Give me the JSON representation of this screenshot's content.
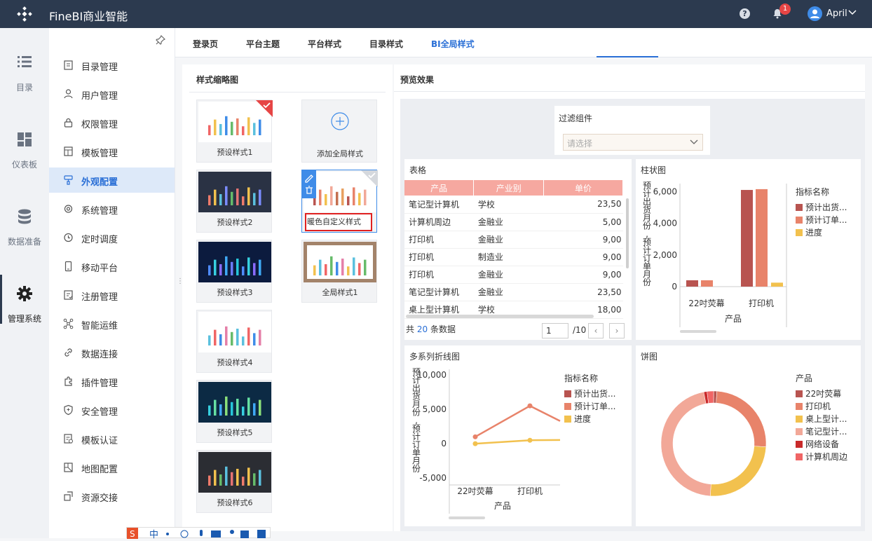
{
  "header": {
    "title": "FineBI商业智能",
    "notifications": "1",
    "user": "April"
  },
  "rail": [
    {
      "label": "目录",
      "icon": "list-icon"
    },
    {
      "label": "仪表板",
      "icon": "dashboard-icon"
    },
    {
      "label": "数据准备",
      "icon": "database-icon"
    },
    {
      "label": "管理系统",
      "icon": "gear-icon"
    }
  ],
  "menu": [
    {
      "label": "目录管理",
      "icon": "catalog-icon"
    },
    {
      "label": "用户管理",
      "icon": "user-icon"
    },
    {
      "label": "权限管理",
      "icon": "lock-icon"
    },
    {
      "label": "模板管理",
      "icon": "template-icon"
    },
    {
      "label": "外观配置",
      "icon": "brush-icon"
    },
    {
      "label": "系统管理",
      "icon": "gear-icon"
    },
    {
      "label": "定时调度",
      "icon": "clock-icon"
    },
    {
      "label": "移动平台",
      "icon": "mobile-icon"
    },
    {
      "label": "注册管理",
      "icon": "register-icon"
    },
    {
      "label": "智能运维",
      "icon": "ops-icon"
    },
    {
      "label": "数据连接",
      "icon": "link-icon"
    },
    {
      "label": "插件管理",
      "icon": "plugin-icon"
    },
    {
      "label": "安全管理",
      "icon": "shield-icon"
    },
    {
      "label": "模板认证",
      "icon": "certify-icon"
    },
    {
      "label": "地图配置",
      "icon": "map-icon"
    },
    {
      "label": "资源交接",
      "icon": "transfer-icon"
    }
  ],
  "tabs": [
    "登录页",
    "平台主题",
    "平台样式",
    "目录样式",
    "BI全局样式"
  ],
  "thumbs": {
    "title": "样式缩略图",
    "items": [
      "预设样式1",
      "添加全局样式",
      "预设样式2",
      "暖色自定义样式",
      "预设样式3",
      "全局样式1",
      "预设样式4",
      "预设样式5",
      "预设样式6"
    ]
  },
  "preview": {
    "title": "预览效果",
    "filter": {
      "title": "过滤组件",
      "placeholder": "请选择"
    },
    "table": {
      "title": "表格",
      "headers": [
        "产品",
        "产业别",
        "单价"
      ],
      "rows": [
        [
          "笔记型计算机",
          "学校",
          "23,50"
        ],
        [
          "计算机周边",
          "金融业",
          "5,00"
        ],
        [
          "打印机",
          "金融业",
          "9,00"
        ],
        [
          "打印机",
          "制造业",
          "9,00"
        ],
        [
          "打印机",
          "金融业",
          "9,00"
        ],
        [
          "笔记型计算机",
          "金融业",
          "23,50"
        ],
        [
          "桌上型计算机",
          "学校",
          "18,00"
        ]
      ],
      "pager": {
        "prefix": "共",
        "count": "20",
        "suffix": "条数据",
        "page": "1",
        "total": "/10"
      }
    },
    "bar": {
      "title": "柱状图",
      "legend_title": "指标名称",
      "legend": [
        "预计出货...",
        "预计订单...",
        "进度"
      ]
    },
    "line": {
      "title": "多系列折线图",
      "legend_title": "指标名称",
      "legend": [
        "预计出货...",
        "预计订单...",
        "进度"
      ]
    },
    "pie": {
      "title": "饼图",
      "legend_title": "产品",
      "legend": [
        "22吋荧幕",
        "打印机",
        "桌上型计...",
        "笔记型计...",
        "网络设备",
        "计算机周边"
      ]
    }
  },
  "chart_data": [
    {
      "type": "bar",
      "title": "柱状图",
      "categories": [
        "22吋荧幕",
        "打印机"
      ],
      "xlabel": "产品",
      "ylabel": "预计出货月份,预计订单月份",
      "ylim": [
        0,
        6500
      ],
      "yticks": [
        "0",
        "2,000",
        "4,000",
        "6,000"
      ],
      "series": [
        {
          "name": "预计出货...",
          "values": [
            400,
            6100
          ],
          "color": "#b85450"
        },
        {
          "name": "预计订单...",
          "values": [
            400,
            6150
          ],
          "color": "#e8836a"
        },
        {
          "name": "进度",
          "values": [
            0,
            250
          ],
          "color": "#f2c14e"
        }
      ]
    },
    {
      "type": "line",
      "title": "多系列折线图",
      "categories": [
        "22吋荧幕",
        "打印机"
      ],
      "xlabel": "产品",
      "ylabel": "预计出货月份,预计订单月份",
      "ylim": [
        -6000,
        10000
      ],
      "yticks": [
        "-5,000",
        "0",
        "5,000",
        "10,000"
      ],
      "series": [
        {
          "name": "预计出货...",
          "values": [
            null,
            null
          ],
          "color": "#b85450"
        },
        {
          "name": "预计订单...",
          "values": [
            1000,
            5500
          ],
          "color": "#e8836a"
        },
        {
          "name": "进度",
          "values": [
            0,
            500
          ],
          "color": "#f2c14e"
        }
      ]
    },
    {
      "type": "pie",
      "title": "饼图",
      "categories": [
        "22吋荧幕",
        "打印机",
        "桌上型计...",
        "笔记型计...",
        "网络设备",
        "计算机周边"
      ],
      "values": [
        1,
        25,
        25,
        46,
        1,
        2
      ],
      "colors": [
        "#b85450",
        "#e8836a",
        "#f2c14e",
        "#f2a898",
        "#c92a2a",
        "#f06565"
      ]
    }
  ]
}
